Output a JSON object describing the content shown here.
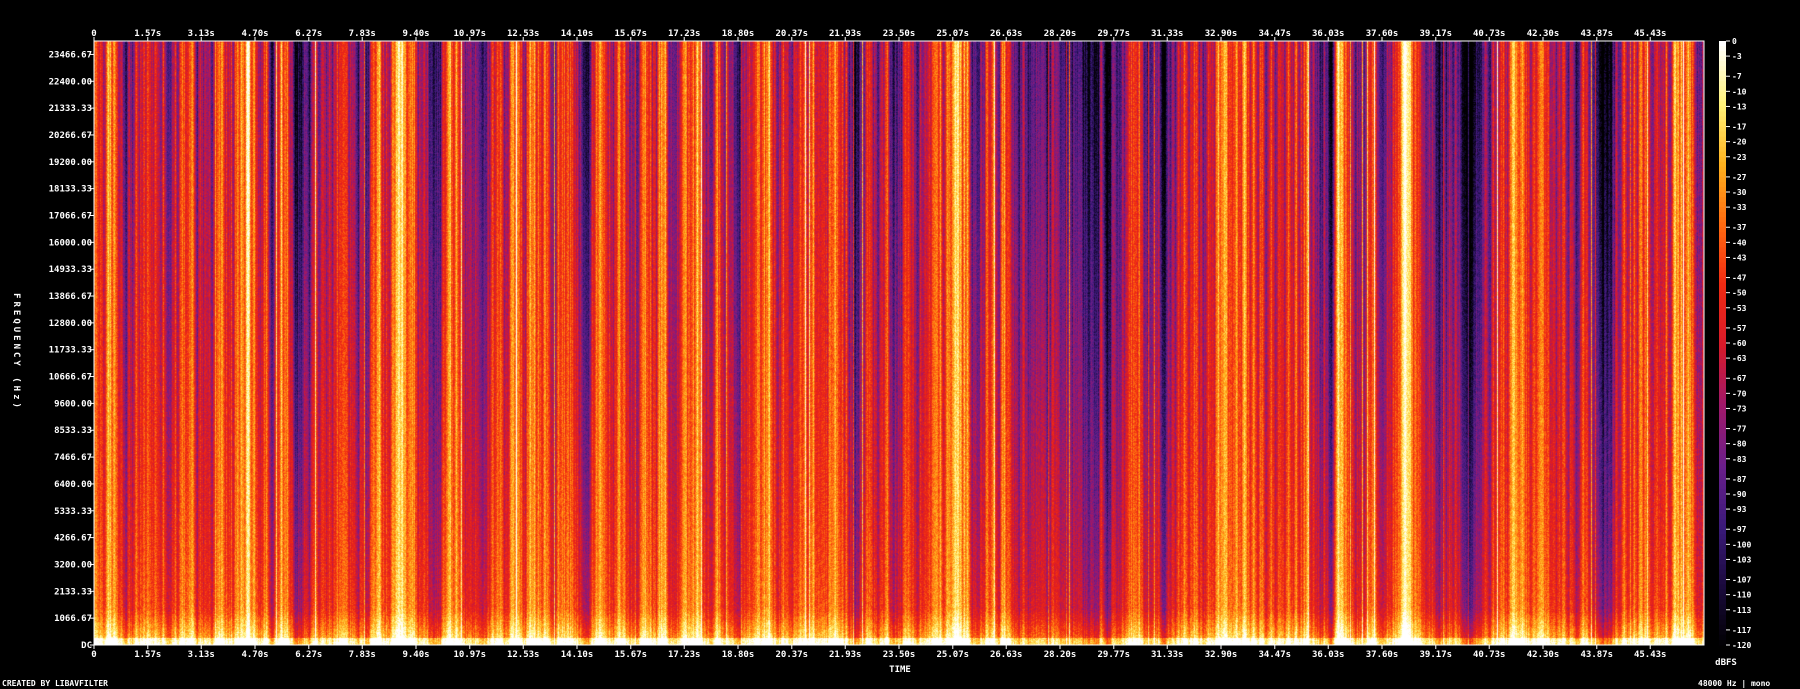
{
  "chart_data": {
    "type": "heatmap",
    "title": "",
    "xlabel": "TIME",
    "ylabel": "FREQUENCY (Hz)",
    "x_ticks": [
      "0",
      "1.57s",
      "3.13s",
      "4.70s",
      "6.27s",
      "7.83s",
      "9.40s",
      "10.97s",
      "12.53s",
      "14.10s",
      "15.67s",
      "17.23s",
      "18.80s",
      "20.37s",
      "21.93s",
      "23.50s",
      "25.07s",
      "26.63s",
      "28.20s",
      "29.77s",
      "31.33s",
      "32.90s",
      "34.47s",
      "36.03s",
      "37.60s",
      "39.17s",
      "40.73s",
      "42.30s",
      "43.87s",
      "45.43s"
    ],
    "x_range": [
      0,
      47.0
    ],
    "y_ticks": [
      "DC",
      "1066.67",
      "2133.33",
      "3200.00",
      "4266.67",
      "5333.33",
      "6400.00",
      "7466.67",
      "8533.33",
      "9600.00",
      "10666.67",
      "11733.33",
      "12800.00",
      "13866.67",
      "14933.33",
      "16000.00",
      "17066.67",
      "18133.33",
      "19200.00",
      "20266.67",
      "21333.33",
      "22400.00",
      "23466.67"
    ],
    "y_range": [
      0,
      24000
    ],
    "colorbar_ticks": [
      "0",
      "-3",
      "-7",
      "-10",
      "-13",
      "-17",
      "-20",
      "-23",
      "-27",
      "-30",
      "-33",
      "-37",
      "-40",
      "-43",
      "-47",
      "-50",
      "-53",
      "-57",
      "-60",
      "-63",
      "-67",
      "-70",
      "-73",
      "-77",
      "-80",
      "-83",
      "-87",
      "-90",
      "-93",
      "-97",
      "-100",
      "-103",
      "-107",
      "-110",
      "-113",
      "-117",
      "-120"
    ],
    "colorbar_range": [
      -120,
      0
    ],
    "colorbar_unit": "dBFS",
    "colormap": [
      "#000000",
      "#1a0a3c",
      "#3b1a7a",
      "#6a1e8a",
      "#a0186a",
      "#d81a2a",
      "#f02a12",
      "#ff6a10",
      "#ffb21e",
      "#fff27a",
      "#ffffff"
    ],
    "footer_left": "CREATED BY LIBAVFILTER",
    "footer_right": "48000 Hz | mono"
  }
}
